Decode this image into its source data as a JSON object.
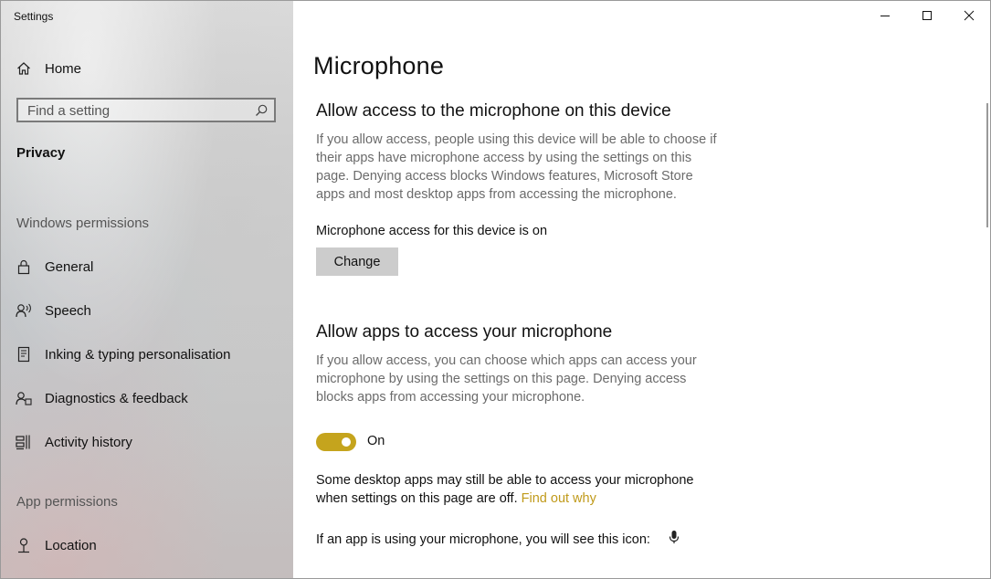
{
  "window": {
    "title": "Settings"
  },
  "sidebar": {
    "home_label": "Home",
    "search": {
      "placeholder": "Find a setting"
    },
    "category_title": "Privacy",
    "windows_permissions_header": "Windows permissions",
    "windows_permissions_items": [
      {
        "label": "General",
        "icon": "lock-icon"
      },
      {
        "label": "Speech",
        "icon": "speech-icon"
      },
      {
        "label": "Inking & typing personalisation",
        "icon": "inking-icon"
      },
      {
        "label": "Diagnostics & feedback",
        "icon": "diagnostics-icon"
      },
      {
        "label": "Activity history",
        "icon": "activity-history-icon"
      }
    ],
    "app_permissions_header": "App permissions",
    "app_permissions_items": [
      {
        "label": "Location",
        "icon": "location-icon"
      }
    ]
  },
  "main": {
    "page_title": "Microphone",
    "device_section": {
      "heading": "Allow access to the microphone on this device",
      "description": "If you allow access, people using this device will be able to choose if their apps have microphone access by using the settings on this page. Denying access blocks Windows features, Microsoft Store apps and most desktop apps from accessing the microphone.",
      "status": "Microphone access for this device is on",
      "change_label": "Change"
    },
    "apps_section": {
      "heading": "Allow apps to access your microphone",
      "description": "If you allow access, you can choose which apps can access your microphone by using the settings on this page. Denying access blocks apps from accessing your microphone.",
      "toggle_state": "On",
      "note_prefix": "Some desktop apps may still be able to access your microphone when settings on this page are off.",
      "note_link": "Find out why",
      "icon_note": "If an app is using your microphone, you will see this icon:"
    }
  },
  "colors": {
    "accent": "#c5a41d",
    "link": "#c09a1a"
  }
}
